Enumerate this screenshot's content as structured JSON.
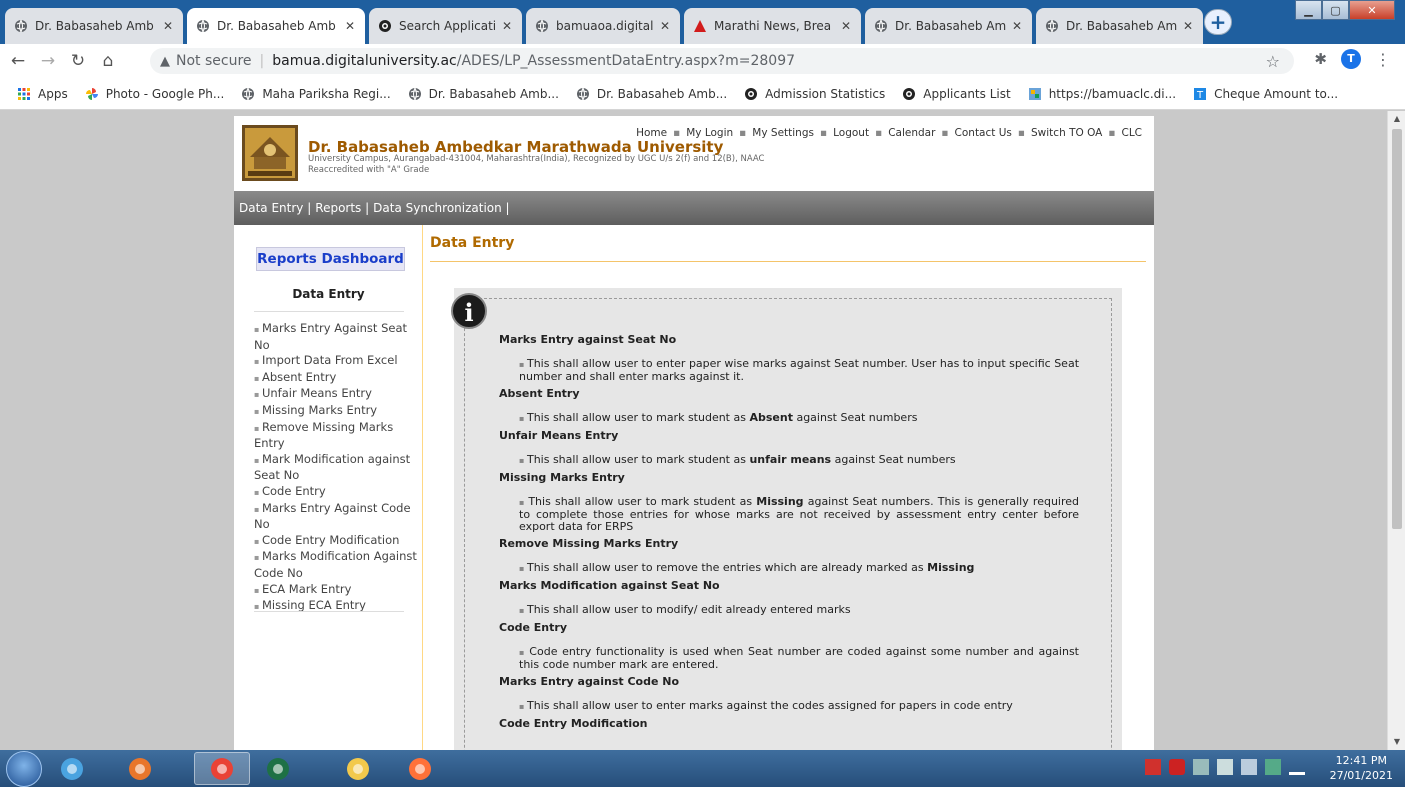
{
  "browser": {
    "tabs": [
      {
        "label": "Dr. Babasaheb Amb",
        "icon": "globe-icon",
        "active": false
      },
      {
        "label": "Dr. Babasaheb Amb",
        "icon": "globe-icon",
        "active": true
      },
      {
        "label": "Search Application",
        "icon": "app-logo-icon",
        "active": false
      },
      {
        "label": "bamuaoa.digitaluni",
        "icon": "globe-icon",
        "active": false
      },
      {
        "label": "Marathi News, Brea",
        "icon": "red-triangle-icon",
        "active": false
      },
      {
        "label": "Dr. Babasaheb Amb",
        "icon": "globe-icon",
        "active": false
      },
      {
        "label": "Dr. Babasaheb Amb",
        "icon": "globe-icon",
        "active": false
      }
    ],
    "new_tab_label": "+",
    "address": {
      "security_label": "Not secure",
      "host": "bamua.digitaluniversity.ac",
      "path": "/ADES/LP_AssessmentDataEntry.aspx?m=28097"
    },
    "profile_initial": "T",
    "bookmarks": [
      {
        "label": "Apps",
        "icon": "apps-grid-icon"
      },
      {
        "label": "Photo - Google Ph...",
        "icon": "google-photos-icon"
      },
      {
        "label": "Maha Pariksha Regi...",
        "icon": "globe-icon"
      },
      {
        "label": "Dr. Babasaheb Amb...",
        "icon": "globe-icon"
      },
      {
        "label": "Dr. Babasaheb Amb...",
        "icon": "globe-icon"
      },
      {
        "label": "Admission Statistics",
        "icon": "app-logo-icon"
      },
      {
        "label": "Applicants List",
        "icon": "app-logo-icon"
      },
      {
        "label": "https://bamuaclc.di...",
        "icon": "colorful-tile-icon"
      },
      {
        "label": "Cheque Amount to...",
        "icon": "t-tile-icon"
      }
    ]
  },
  "site": {
    "university_name": "Dr. Babasaheb Ambedkar Marathwada University",
    "university_sub_1": "University Campus, Aurangabad-431004, Maharashtra(India), Recognized by UGC U/s 2(f) and 12(B), NAAC",
    "university_sub_2": "Reaccredited with \"A\" Grade",
    "top_links": [
      "Home",
      "My Login",
      "My Settings",
      "Logout",
      "Calendar",
      "Contact Us",
      "Switch TO OA",
      "CLC"
    ],
    "menu": [
      "Data Entry |",
      "Reports |",
      "Data Synchronization |"
    ],
    "sidebar": {
      "title": "Reports Dashboard",
      "section": "Data Entry",
      "items": [
        "Marks Entry Against Seat No",
        "Import Data From Excel",
        "Absent Entry",
        "Unfair Means Entry",
        "Missing Marks Entry",
        "Remove Missing Marks Entry",
        "Mark Modification against Seat No",
        "Code Entry",
        "Marks Entry Against Code No",
        "Code Entry Modification",
        "Marks Modification Against Code No",
        "ECA Mark Entry",
        "Missing ECA Entry"
      ]
    },
    "content": {
      "title": "Data Entry",
      "info_icon": "i",
      "items": [
        {
          "heading": "Marks Entry against Seat No",
          "text": "This shall allow user to enter paper wise marks against Seat number. User has to input specific Seat number and shall enter marks against it."
        },
        {
          "heading": "Absent Entry",
          "text_before": "This shall allow user to mark student as ",
          "emphasis": "Absent",
          "text_after": " against Seat numbers"
        },
        {
          "heading": "Unfair Means Entry",
          "text_before": "This shall allow user to mark student as ",
          "emphasis": "unfair means",
          "text_after": " against Seat numbers"
        },
        {
          "heading": "Missing Marks Entry",
          "text_before": "This shall allow user to mark student as ",
          "emphasis": "Missing",
          "text_after": " against Seat numbers. This is generally required to complete those entries for whose marks are not received by assessment entry center before export data for ERPS"
        },
        {
          "heading": "Remove Missing Marks Entry",
          "text_before": "This shall allow user to remove the entries which are already marked as ",
          "emphasis": "Missing",
          "text_after": ""
        },
        {
          "heading": "Marks Modification against Seat No",
          "text": "This shall allow user to modify/ edit already entered marks"
        },
        {
          "heading": "Code Entry",
          "text": "Code entry functionality is used when Seat number are coded against some number and against this code number mark are entered."
        },
        {
          "heading": "Marks Entry against Code No",
          "text": "This shall allow user to enter marks against the codes assigned for papers in code entry"
        },
        {
          "heading": "Code Entry Modification",
          "text": ""
        }
      ]
    }
  },
  "taskbar": {
    "apps": [
      "ie-icon",
      "office-icon",
      "chrome-icon",
      "excel-icon",
      "file-explorer-icon",
      "firefox-icon"
    ],
    "time": "12:41 PM",
    "date": "27/01/2021"
  },
  "colors": {
    "titlebar": "#1f5f9f",
    "university_brown": "#9e5a00",
    "dashboard_blue": "#1a3ec9",
    "content_title": "#b06a00"
  }
}
